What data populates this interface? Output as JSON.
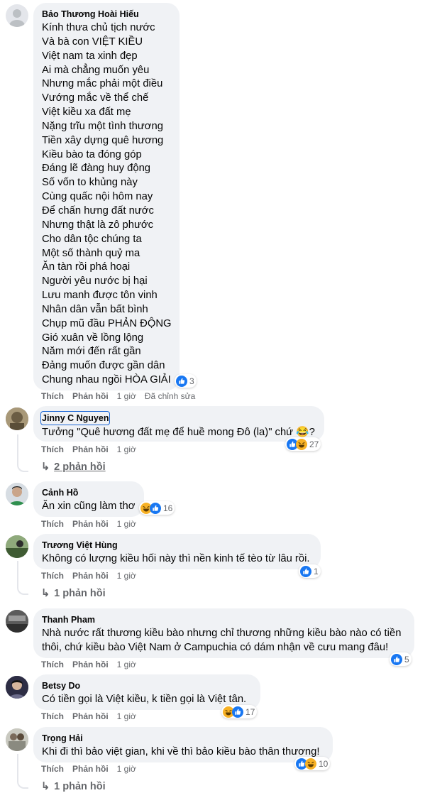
{
  "comments": [
    {
      "author": "Bảo Thương Hoài Hiếu",
      "lines": [
        "Kính thưa chủ tịch nước",
        "Và bà con VIỆT KIỀU",
        "Việt nam ta xinh đẹp",
        "Ai mà chẳng muốn yêu",
        "Nhưng mắc phải một điều",
        "Vướng mắc về thể chế",
        "Việt kiều xa đất mẹ",
        "Nặng trĩu một tình thương",
        "Tiền xây dựng quê hương",
        "Kiều bào ta đóng góp",
        "Đáng lẽ đàng huy động",
        "Số vốn to khủng này",
        "Cùng quấc nội hôm nay",
        "Để chấn hưng đất nước",
        "Nhưng thật là zô phước",
        "Cho dân tộc chúng ta",
        "Một số thành quỷ ma",
        "Ăn tàn rồi phá hoại",
        "Người yêu nước bị hại",
        "Lưu manh được tôn vinh",
        "Nhân dân vẫn bất bình",
        "Chụp mũ đầu PHẢN ĐỘNG",
        "Gió xuân về lồng lộng",
        "Năm mới đến rất gần",
        "Đảng muốn được gần dân",
        "Chung nhau ngồi HÒA GIẢI"
      ],
      "like_label": "Thích",
      "reply_label": "Phản hồi",
      "time": "1 giờ",
      "edited": "Đã chỉnh sửa",
      "reaction_icons": [
        "like"
      ],
      "reaction_count": "3",
      "replies_text": ""
    },
    {
      "author": "Jinny C Nguyen",
      "lines": [
        "Tưởng \"Quê hương đất mẹ để huề mong Đô (la)\" chứ 😂?"
      ],
      "like_label": "Thích",
      "reply_label": "Phản hồi",
      "time": "1 giờ",
      "edited": "",
      "reaction_icons": [
        "like",
        "haha"
      ],
      "reaction_count": "27",
      "replies_text": "2 phản hồi"
    },
    {
      "author": "Cảnh Hồ",
      "lines": [
        "Ăn xin cũng làm thơ"
      ],
      "like_label": "Thích",
      "reply_label": "Phản hồi",
      "time": "1 giờ",
      "edited": "",
      "reaction_icons": [
        "haha",
        "like"
      ],
      "reaction_count": "16",
      "replies_text": ""
    },
    {
      "author": "Trương Việt Hùng",
      "lines": [
        "Không có lượng kiều hối này thì nền kinh tế tèo từ lâu rồi."
      ],
      "like_label": "Thích",
      "reply_label": "Phản hồi",
      "time": "1 giờ",
      "edited": "",
      "reaction_icons": [
        "like"
      ],
      "reaction_count": "1",
      "replies_text": "1 phản hồi"
    },
    {
      "author": "Thanh Pham",
      "lines": [
        "Nhà nước rất thương kiều bào nhưng chỉ thương những kiều bào nào có tiền",
        "thôi, chứ kiều bào Việt Nam ở Campuchia có dám nhận về cưu mang đâu!"
      ],
      "like_label": "Thích",
      "reply_label": "Phản hồi",
      "time": "1 giờ",
      "edited": "",
      "reaction_icons": [
        "like"
      ],
      "reaction_count": "5",
      "replies_text": ""
    },
    {
      "author": "Betsy Do",
      "lines": [
        "Có tiền gọi là Việt kiều, k tiền gọi là Việt tân."
      ],
      "like_label": "Thích",
      "reply_label": "Phản hồi",
      "time": "1 giờ",
      "edited": "",
      "reaction_icons": [
        "haha",
        "like"
      ],
      "reaction_count": "17",
      "replies_text": ""
    },
    {
      "author": "Trọng Hải",
      "lines": [
        "Khi đi thì bảo việt gian, khi về thì bảo kiều bào thân thương!"
      ],
      "like_label": "Thích",
      "reply_label": "Phản hồi",
      "time": "1 giờ",
      "edited": "",
      "reaction_icons": [
        "like",
        "haha"
      ],
      "reaction_count": "10",
      "replies_text": "1 phản hồi"
    }
  ],
  "colors": {
    "bubble": "#f0f2f5",
    "secondary_text": "#65676b",
    "like_blue": "#1877f2",
    "haha_yellow": "#f7b125",
    "selection_outline": "#1a66d6"
  }
}
